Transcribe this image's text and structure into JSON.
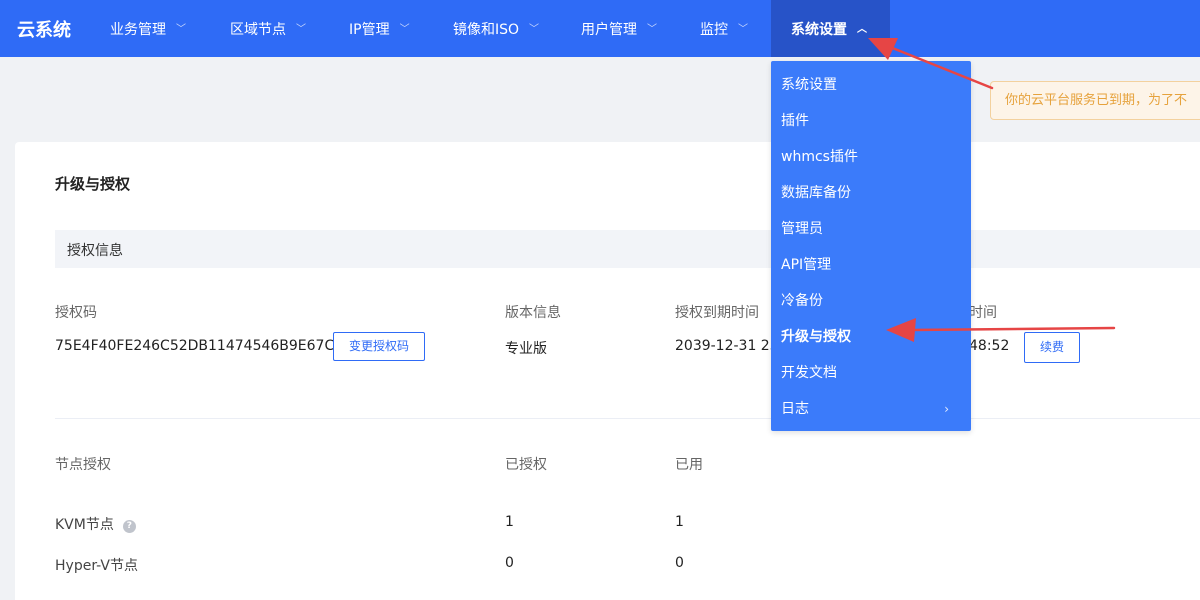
{
  "nav": {
    "brand": "云系统",
    "items": [
      {
        "label": "业务管理"
      },
      {
        "label": "区域节点"
      },
      {
        "label": "IP管理"
      },
      {
        "label": "镜像和ISO"
      },
      {
        "label": "用户管理"
      },
      {
        "label": "监控"
      },
      {
        "label": "系统设置"
      }
    ],
    "chevron_down": "﹀",
    "chevron_up": "︿"
  },
  "dropdown": {
    "items": [
      {
        "label": "系统设置"
      },
      {
        "label": "插件"
      },
      {
        "label": "whmcs插件"
      },
      {
        "label": "数据库备份"
      },
      {
        "label": "管理员"
      },
      {
        "label": "API管理"
      },
      {
        "label": "冷备份"
      },
      {
        "label": "升级与授权"
      },
      {
        "label": "开发文档"
      },
      {
        "label": "日志"
      }
    ],
    "submenu_arrow": "›"
  },
  "notice": {
    "text": "你的云平台服务已到期，为了不"
  },
  "card": {
    "title": "升级与授权",
    "section": "授权信息",
    "license": {
      "code_label": "授权码",
      "code_value": "75E4F40FE246C52DB11474546B9E67CB",
      "change_button": "变更授权码",
      "version_label": "版本信息",
      "version_value": "专业版",
      "expire_label": "授权到期时间",
      "expire_value": "2039-12-31 23:",
      "time_label_partial": "时间",
      "time_value_partial": "48:52",
      "renew_button": "续费"
    },
    "nodes": {
      "header": {
        "type": "节点授权",
        "authorized": "已授权",
        "used": "已用"
      },
      "help_glyph": "?",
      "rows": [
        {
          "name": "KVM节点",
          "authorized": "1",
          "used": "1"
        },
        {
          "name": "Hyper-V节点",
          "authorized": "0",
          "used": "0"
        }
      ]
    }
  },
  "colors": {
    "topbar": "#2f6bf6",
    "active_nav": "#2753c8",
    "dropdown": "#3b7bfa",
    "annotation_arrow": "#e64545",
    "notice_text": "#e6a23c"
  }
}
